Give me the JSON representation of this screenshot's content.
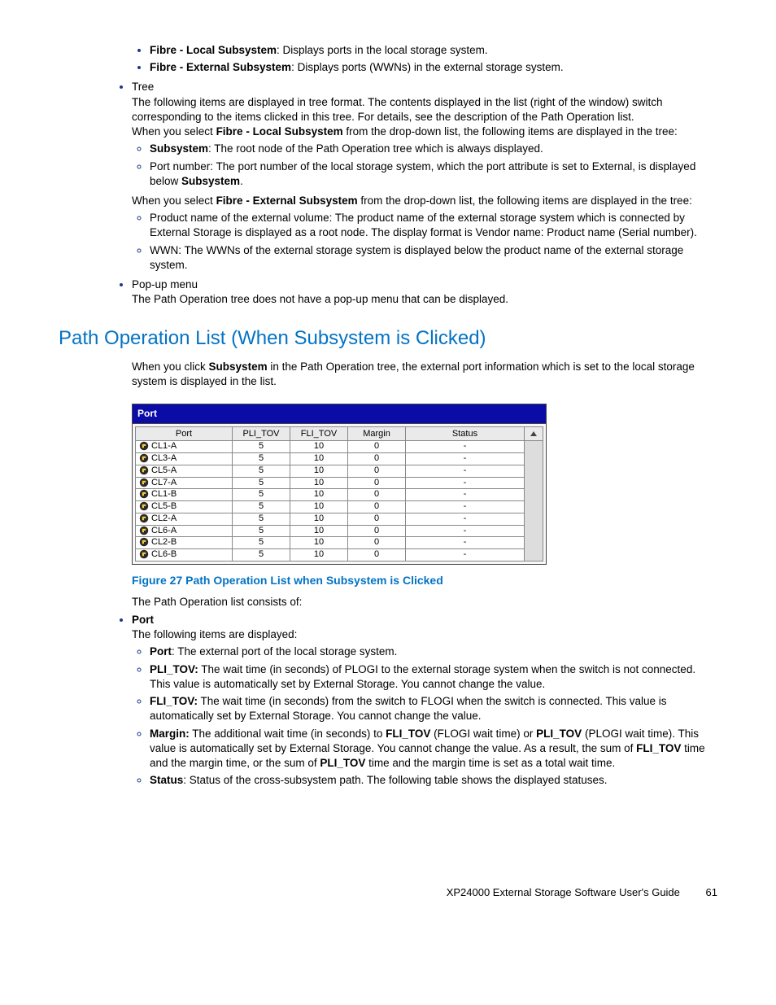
{
  "bullets_top": {
    "fibre_local_label": "Fibre - Local Subsystem",
    "fibre_local_text": ": Displays ports in the local storage system.",
    "fibre_ext_label": "Fibre - External Subsystem",
    "fibre_ext_text": ": Displays ports (WWNs) in the external storage system."
  },
  "tree": {
    "label": "Tree",
    "para1": "The following items are displayed in tree format. The contents displayed in the list (right of the window) switch corresponding to the items clicked in this tree. For details, see the description of the Path Operation list.",
    "para2_a": "When you select ",
    "para2_bold": "Fibre - Local Subsystem",
    "para2_b": " from the drop-down list, the following items are displayed in the tree:",
    "sub1_bold": "Subsystem",
    "sub1_text": ": The root node of the Path Operation tree which is always displayed.",
    "sub2_a": "Port number: The port number of the local storage system, which the port attribute is set to External, is displayed below ",
    "sub2_bold": "Subsystem",
    "sub2_b": ".",
    "para3_a": "When you select ",
    "para3_bold": "Fibre - External Subsystem",
    "para3_b": " from the drop-down list, the following items are displayed in the tree:",
    "ext1": "Product name of the external volume: The product name of the external storage system which is connected by External Storage is displayed as a root node. The display format is Vendor name: Product name (Serial number).",
    "ext2": "WWN: The WWNs of the external storage system is displayed below the product name of the external storage system."
  },
  "popup": {
    "label": "Pop-up menu",
    "text": "The Path Operation tree does not have a pop-up menu that can be displayed."
  },
  "section_heading": "Path Operation List (When Subsystem is Clicked)",
  "section_para_a": "When you click ",
  "section_para_bold": "Subsystem",
  "section_para_b": " in the Path Operation tree, the external port information which is set to the local storage system is displayed in the list.",
  "port_panel": {
    "header": "Port",
    "columns": [
      "Port",
      "PLI_TOV",
      "FLI_TOV",
      "Margin",
      "Status"
    ],
    "rows": [
      {
        "port": "CL1-A",
        "pli": "5",
        "fli": "10",
        "margin": "0",
        "status": "-"
      },
      {
        "port": "CL3-A",
        "pli": "5",
        "fli": "10",
        "margin": "0",
        "status": "-"
      },
      {
        "port": "CL5-A",
        "pli": "5",
        "fli": "10",
        "margin": "0",
        "status": "-"
      },
      {
        "port": "CL7-A",
        "pli": "5",
        "fli": "10",
        "margin": "0",
        "status": "-"
      },
      {
        "port": "CL1-B",
        "pli": "5",
        "fli": "10",
        "margin": "0",
        "status": "-"
      },
      {
        "port": "CL5-B",
        "pli": "5",
        "fli": "10",
        "margin": "0",
        "status": "-"
      },
      {
        "port": "CL2-A",
        "pli": "5",
        "fli": "10",
        "margin": "0",
        "status": "-"
      },
      {
        "port": "CL6-A",
        "pli": "5",
        "fli": "10",
        "margin": "0",
        "status": "-"
      },
      {
        "port": "CL2-B",
        "pli": "5",
        "fli": "10",
        "margin": "0",
        "status": "-"
      },
      {
        "port": "CL6-B",
        "pli": "5",
        "fli": "10",
        "margin": "0",
        "status": "-"
      }
    ]
  },
  "figure_caption": "Figure 27 Path Operation List when Subsystem is Clicked",
  "list_intro": "The Path Operation list consists of:",
  "port_section": {
    "label": "Port",
    "intro": "The following items are displayed:",
    "i1_bold": "Port",
    "i1_text": ": The external port of the local storage system.",
    "i2_bold": "PLI_TOV:",
    "i2_text": " The wait time (in seconds) of PLOGI to the external storage system when the switch is not connected. This value is automatically set by External Storage. You cannot change the value.",
    "i3_bold": "FLI_TOV:",
    "i3_text": " The wait time (in seconds) from the switch to FLOGI when the switch is connected. This value is automatically set by External Storage. You cannot change the value.",
    "i4_bold": "Margin:",
    "i4_a": " The additional wait time (in seconds) to ",
    "i4_b1": "FLI_TOV",
    "i4_b": " (FLOGI wait time) or ",
    "i4_b2": "PLI_TOV",
    "i4_c": " (PLOGI wait time). This value is automatically set by External Storage. You cannot change the value. As a result, the sum of ",
    "i4_b3": "FLI_TOV",
    "i4_d": " time and the margin time, or the sum of ",
    "i4_b4": "PLI_TOV",
    "i4_e": " time and the margin time is set as a total wait time.",
    "i5_bold": "Status",
    "i5_text": ": Status of the cross-subsystem path. The following table shows the displayed statuses."
  },
  "footer": {
    "guide": "XP24000 External Storage Software User's Guide",
    "page": "61"
  }
}
